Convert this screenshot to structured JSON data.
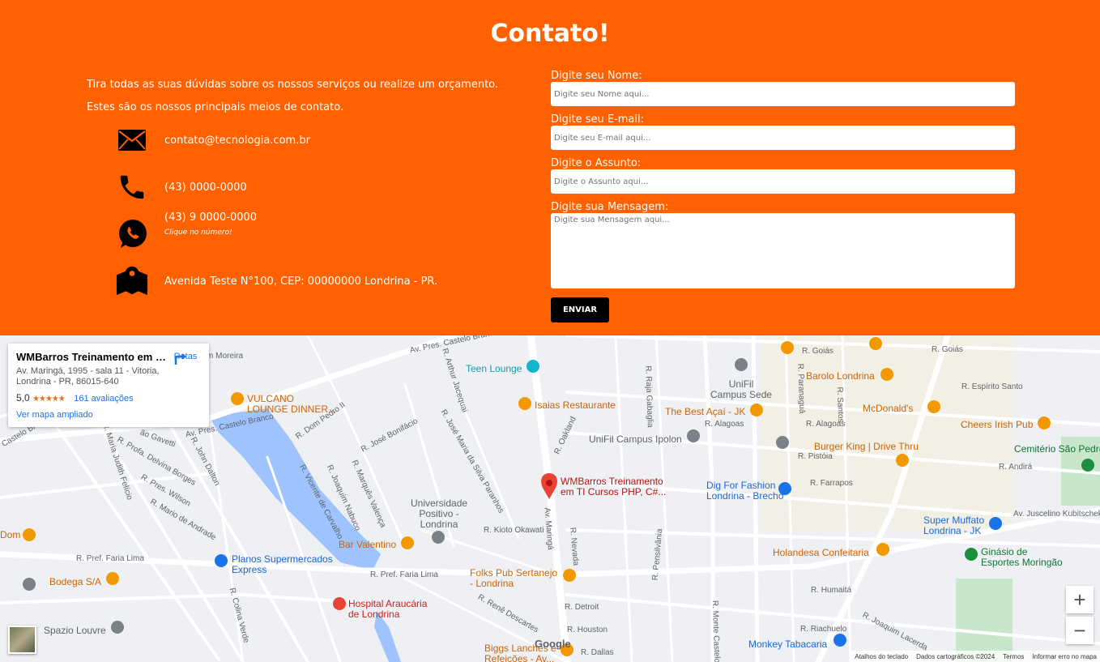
{
  "contact": {
    "title": "Contato!",
    "intro_1": "Tira todas as suas dúvidas sobre os nossos serviços ou realize um orçamento.",
    "intro_2": "Estes são os nossos principais meios de contato.",
    "email": "contato@tecnologia.com.br",
    "phone": "(43) 0000-0000",
    "whatsapp": "(43) 9 0000-0000",
    "whatsapp_hint": "Clique no número!",
    "address": "Avenida Teste N°100, CEP: 00000000 Londrina - PR."
  },
  "form": {
    "name_label": "Digite seu Nome:",
    "name_placeholder": "Digite seu Nome aqui...",
    "email_label": "Digite seu E-mail:",
    "email_placeholder": "Digite seu E-mail aqui...",
    "subject_label": "Digite o Assunto:",
    "subject_placeholder": "Digite o Assunto aqui...",
    "message_label": "Digite sua Mensagem:",
    "message_placeholder": "Digite sua Mensagem aqui...",
    "submit": "ENVIAR"
  },
  "map": {
    "card": {
      "title": "WMBarros Treinamento em TI...",
      "address": "Av. Maringá, 1995 - sala 11 - Vitoria, Londrina - PR, 86015-640",
      "rating": "5,0",
      "stars": "★★★★★",
      "reviews": "161 avaliações",
      "larger_map": "Ver mapa ampliado",
      "directions": "Rotas"
    },
    "pin_label_1": "WMBarros Treinamento",
    "pin_label_2": "em TI Cursos PHP, C#...",
    "places": {
      "teen_lounge": "Teen Lounge",
      "isaias": "Isaias Restaurante",
      "vulcano_1": "VULCANO",
      "vulcano_2": "LOUNGE DINNER...",
      "unifil_1": "UniFil",
      "unifil_2": "Campus Sede",
      "best_acai": "The Best Açaí - JK",
      "unifil_ipolon": "UniFil Campus Ipolon",
      "barolo": "Barolo Londrina",
      "mcdonalds": "McDonald's",
      "cheers": "Cheers Irish Pub",
      "burger_king": "Burger King | Drive Thru",
      "cemiterio": "Cemitério São Pedro",
      "dig_1": "Dig For Fashion",
      "dig_2": "Londrina - Brechó",
      "super_muffato_1": "Super Muffato",
      "super_muffato_2": "Londrina - JK",
      "univ_1": "Universidade",
      "univ_2": "Positivo -",
      "univ_3": "Londrina",
      "bar_valentino": "Bar Valentino",
      "planos_1": "Planos Supermercados",
      "planos_2": "Express",
      "folks_1": "Folks Pub Sertanejo",
      "folks_2": "- Londrina",
      "holandesa": "Holandesa Confeitaria",
      "ginasio_1": "Ginásio de",
      "ginasio_2": "Esportes Moringão",
      "bodega": "Bodega S/A",
      "dom": "Dom",
      "hospital_1": "Hospital Araucária",
      "hospital_2": "de Londrina",
      "spazio": "Spazio Louvre",
      "monkey": "Monkey Tabacaria",
      "biggs_1": "Biggs Lanches e",
      "biggs_2": "Refeições - Av..."
    },
    "streets": {
      "pres_castelo": "Av. Pres. Castelo Branco",
      "goias_1": "R. Goiás",
      "goias_2": "R. Goiás",
      "espirito_santo": "R. Espírito Santo",
      "alagoas_1": "R. Alagoas",
      "alagoas_2": "R. Alagoas",
      "pistoia": "R. Pistóia",
      "farrapos": "R. Farrapos",
      "andira": "R. Andirá",
      "juscelino": "Av. Juscelino Kubitschek",
      "faria_lima_1": "R. Pref. Faria Lima",
      "faria_lima_2": "R. Pref. Faria Lima",
      "kioto": "R. Kioto Okawati",
      "humaita": "R. Humaitá",
      "riachuelo": "R. Riachuelo",
      "detroit": "R. Detroit",
      "houston": "R. Houston",
      "dallas": "R. Dallas",
      "av_maringa": "Av. Maringá",
      "oakland": "R. Oakland",
      "raja": "R. Raja Gabaglia",
      "paranagua": "R. Paranaguá",
      "santos": "R. Santos",
      "delfim": "Delfim Moreira",
      "dom_pedro": "R. Dom Pedro II",
      "jose_bonifacio": "R. José Bonifácio",
      "arthur": "R. Arthur Jacequai",
      "jose_maria": "R. José Maria da Silva Paranhos",
      "marques": "R. Marquês Valença",
      "nabuco": "R. Joaquim Nabuco",
      "vicente": "R. Vicente de Carvalho",
      "nevada": "R. Nevada",
      "pensilvania": "R. Pensilvânia",
      "monte_castelo": "R. Monte Castelo",
      "joaquim_lacerda": "R. Joaquim Lacerda",
      "colina_verde": "R. Colina Verde",
      "rene": "R. Renê Descartes",
      "john_dalton": "R. John Dalton",
      "delvina": "R. Profa. Delvina Borges",
      "wilson": "R. Pres. Wilson",
      "mario": "R. Mario de Andrade",
      "judith": "R. Maria Judith Felício",
      "gavetti": "ão Gavetti",
      "castelo_left": "Castelo Br"
    },
    "google": "Google",
    "footer": {
      "shortcuts": "Atalhos do teclado",
      "data": "Dados cartográficos ©2024",
      "terms": "Termos",
      "report": "Informar erro no mapa"
    },
    "zoom_in": "+",
    "zoom_out": "−"
  },
  "colors": {
    "orange": "#ff6100",
    "water": "#9ec3ff",
    "road": "#ffffff",
    "map_bg": "#eef0f3",
    "label_orange": "#c9650a",
    "label_blue": "#1967d2",
    "label_teal": "#137333"
  }
}
